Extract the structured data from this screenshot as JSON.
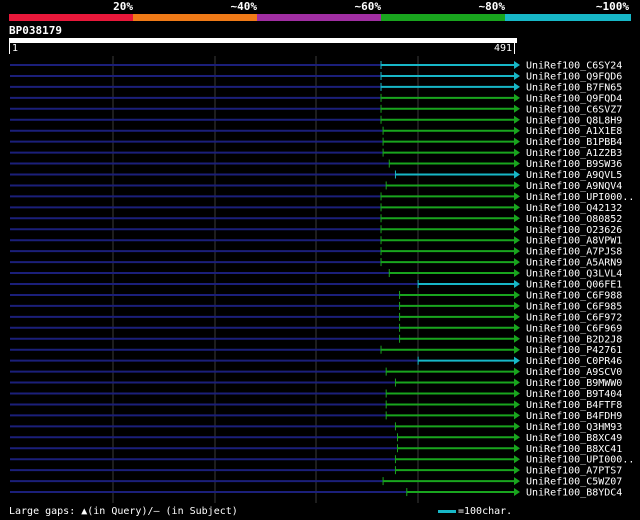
{
  "legend": {
    "labels": [
      "20%",
      "~40%",
      "~60%",
      "~80%",
      "~100%"
    ],
    "colors": [
      "#e8183a",
      "#f07a17",
      "#a12ea2",
      "#19a51e",
      "#17b7c7"
    ]
  },
  "query": {
    "name": "BP038179",
    "start": "1",
    "end": "491",
    "length": 491
  },
  "hits": [
    {
      "name": "UniRef100_C6SY24",
      "start": 361,
      "end": 491,
      "identity_class": 4
    },
    {
      "name": "UniRef100_Q9FQD6",
      "start": 361,
      "end": 491,
      "identity_class": 4
    },
    {
      "name": "UniRef100_B7FN65",
      "start": 361,
      "end": 491,
      "identity_class": 4
    },
    {
      "name": "UniRef100_Q9FQD4",
      "start": 361,
      "end": 491,
      "identity_class": 3
    },
    {
      "name": "UniRef100_C6SVZ7",
      "start": 361,
      "end": 491,
      "identity_class": 3
    },
    {
      "name": "UniRef100_Q8L8H9",
      "start": 361,
      "end": 491,
      "identity_class": 3
    },
    {
      "name": "UniRef100_A1X1E8",
      "start": 363,
      "end": 491,
      "identity_class": 3
    },
    {
      "name": "UniRef100_B1PBB4",
      "start": 363,
      "end": 491,
      "identity_class": 3
    },
    {
      "name": "UniRef100_A1Z2B3",
      "start": 363,
      "end": 491,
      "identity_class": 3
    },
    {
      "name": "UniRef100_B9SW36",
      "start": 369,
      "end": 491,
      "identity_class": 3
    },
    {
      "name": "UniRef100_A9QVL5",
      "start": 375,
      "end": 491,
      "identity_class": 4
    },
    {
      "name": "UniRef100_A9NQV4",
      "start": 366,
      "end": 491,
      "identity_class": 3
    },
    {
      "name": "UniRef100_UPI000..",
      "start": 361,
      "end": 491,
      "identity_class": 3
    },
    {
      "name": "UniRef100_Q42132",
      "start": 361,
      "end": 491,
      "identity_class": 3
    },
    {
      "name": "UniRef100_O80852",
      "start": 361,
      "end": 491,
      "identity_class": 3
    },
    {
      "name": "UniRef100_O23626",
      "start": 361,
      "end": 491,
      "identity_class": 3
    },
    {
      "name": "UniRef100_A8VPW1",
      "start": 361,
      "end": 491,
      "identity_class": 3
    },
    {
      "name": "UniRef100_A7PJS8",
      "start": 361,
      "end": 491,
      "identity_class": 3
    },
    {
      "name": "UniRef100_A5ARN9",
      "start": 361,
      "end": 491,
      "identity_class": 3
    },
    {
      "name": "UniRef100_Q3LVL4",
      "start": 369,
      "end": 491,
      "identity_class": 3
    },
    {
      "name": "UniRef100_Q06FE1",
      "start": 397,
      "end": 491,
      "identity_class": 4
    },
    {
      "name": "UniRef100_C6F988",
      "start": 379,
      "end": 491,
      "identity_class": 3
    },
    {
      "name": "UniRef100_C6F985",
      "start": 379,
      "end": 491,
      "identity_class": 3
    },
    {
      "name": "UniRef100_C6F972",
      "start": 379,
      "end": 491,
      "identity_class": 3
    },
    {
      "name": "UniRef100_C6F969",
      "start": 379,
      "end": 491,
      "identity_class": 3
    },
    {
      "name": "UniRef100_B2D2J8",
      "start": 379,
      "end": 491,
      "identity_class": 3
    },
    {
      "name": "UniRef100_P42761",
      "start": 361,
      "end": 491,
      "identity_class": 3
    },
    {
      "name": "UniRef100_C0PR46",
      "start": 397,
      "end": 491,
      "identity_class": 4
    },
    {
      "name": "UniRef100_A9SCV0",
      "start": 366,
      "end": 491,
      "identity_class": 3
    },
    {
      "name": "UniRef100_B9MWW0",
      "start": 375,
      "end": 491,
      "identity_class": 3
    },
    {
      "name": "UniRef100_B9T404",
      "start": 366,
      "end": 491,
      "identity_class": 3
    },
    {
      "name": "UniRef100_B4FTF8",
      "start": 366,
      "end": 491,
      "identity_class": 3
    },
    {
      "name": "UniRef100_B4FDH9",
      "start": 366,
      "end": 491,
      "identity_class": 3
    },
    {
      "name": "UniRef100_Q3HM93",
      "start": 375,
      "end": 491,
      "identity_class": 3
    },
    {
      "name": "UniRef100_B8XC49",
      "start": 377,
      "end": 491,
      "identity_class": 3
    },
    {
      "name": "UniRef100_B8XC41",
      "start": 377,
      "end": 491,
      "identity_class": 3
    },
    {
      "name": "UniRef100_UPI000..",
      "start": 375,
      "end": 491,
      "identity_class": 3
    },
    {
      "name": "UniRef100_A7PTS7",
      "start": 375,
      "end": 491,
      "identity_class": 3
    },
    {
      "name": "UniRef100_C5WZ07",
      "start": 363,
      "end": 491,
      "identity_class": 3
    },
    {
      "name": "UniRef100_B8YDC4",
      "start": 386,
      "end": 491,
      "identity_class": 3
    }
  ],
  "footer": {
    "large_gaps_text": "Large gaps: ▲(in Query)/– (in Subject)",
    "scale_text": "=100char."
  }
}
